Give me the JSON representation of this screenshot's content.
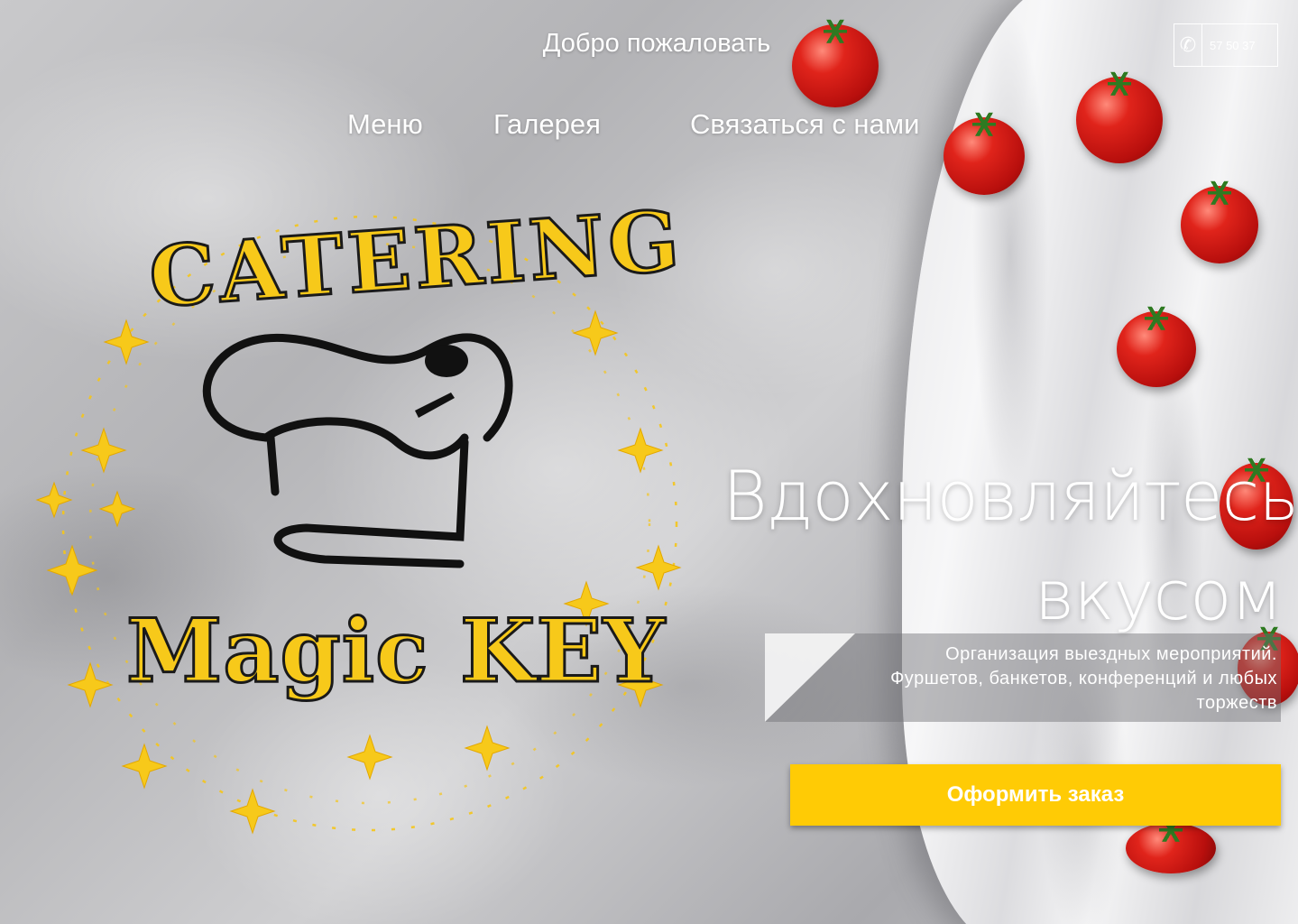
{
  "header": {
    "welcome": "Добро пожаловать",
    "phone": "57 50 37",
    "phone_icon": "phone-icon"
  },
  "nav": {
    "items": [
      {
        "label": "Меню"
      },
      {
        "label": "Галерея"
      },
      {
        "label": "Связаться с нами"
      }
    ]
  },
  "logo": {
    "top_text": "CATERING",
    "bottom_text": "Magic KEY"
  },
  "hero": {
    "headline_line1": "Вдохновляйтесь",
    "headline_line2": "вкусом",
    "description_line1": "Организация выездных мероприятий.",
    "description_line2": "Фуршетов, банкетов, конференций и любых",
    "description_line3": "торжеств",
    "cta_label": "Оформить заказ"
  },
  "colors": {
    "accent": "#ffcb05",
    "logo_gold": "#f7c91a",
    "text": "#ffffff"
  }
}
